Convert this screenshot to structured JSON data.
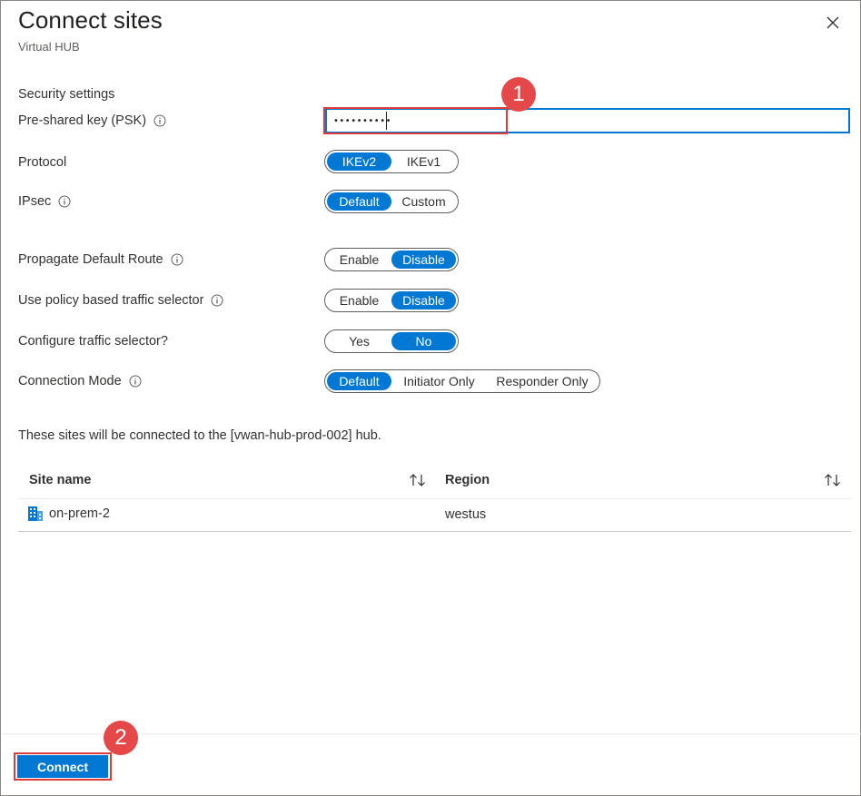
{
  "header": {
    "title": "Connect sites",
    "subtitle": "Virtual HUB"
  },
  "security": {
    "section_title": "Security settings",
    "psk_label": "Pre-shared key (PSK)",
    "psk_value": "••••••••••"
  },
  "settings": [
    {
      "label": "Protocol",
      "info": false,
      "options": [
        "IKEv2",
        "IKEv1"
      ],
      "selected": "IKEv2"
    },
    {
      "label": "IPsec",
      "info": true,
      "options": [
        "Default",
        "Custom"
      ],
      "selected": "Default"
    },
    {
      "label": "Propagate Default Route",
      "info": true,
      "options": [
        "Enable",
        "Disable"
      ],
      "selected": "Disable"
    },
    {
      "label": "Use policy based traffic selector",
      "info": true,
      "options": [
        "Enable",
        "Disable"
      ],
      "selected": "Disable"
    },
    {
      "label": "Configure traffic selector?",
      "info": false,
      "options": [
        "Yes",
        "No"
      ],
      "selected": "No"
    },
    {
      "label": "Connection Mode",
      "info": true,
      "options": [
        "Default",
        "Initiator Only",
        "Responder Only"
      ],
      "selected": "Default"
    }
  ],
  "sites": {
    "note": "These sites will be connected to the [vwan-hub-prod-002] hub.",
    "columns": [
      "Site name",
      "Region"
    ],
    "rows": [
      {
        "site_name": "on-prem-2",
        "region": "westus"
      }
    ]
  },
  "annotations": [
    "1",
    "2"
  ],
  "footer": {
    "connect_label": "Connect"
  },
  "colors": {
    "accent": "#0078d4",
    "annotation": "#e54848"
  }
}
